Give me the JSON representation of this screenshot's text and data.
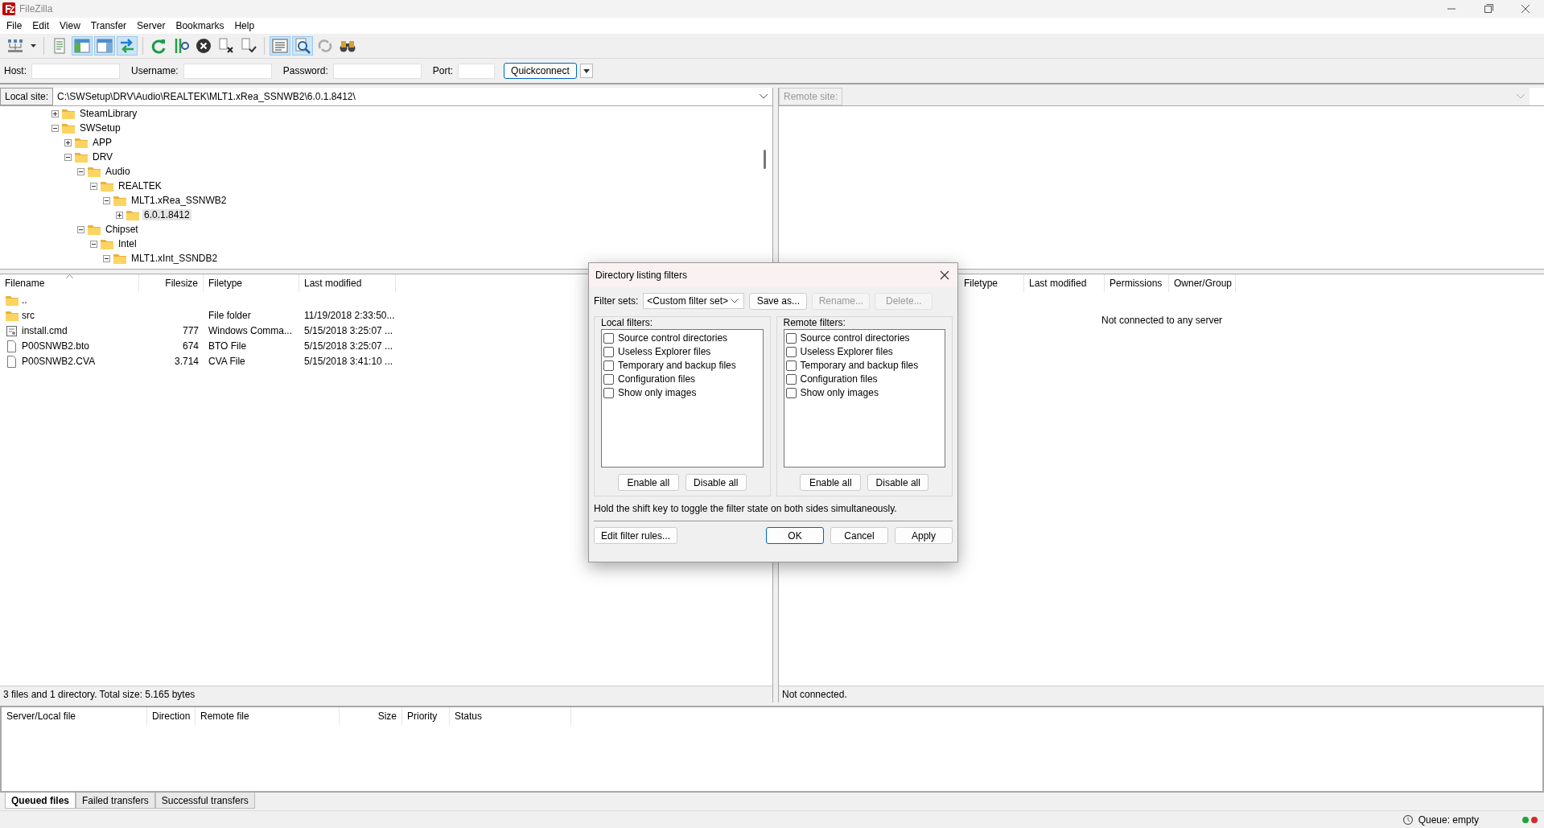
{
  "window": {
    "title": "FileZilla"
  },
  "menu": [
    "File",
    "Edit",
    "View",
    "Transfer",
    "Server",
    "Bookmarks",
    "Help"
  ],
  "toolbar": [
    [
      {
        "kind": "site-manager",
        "pressed": false
      },
      {
        "kind": "dropdown",
        "pressed": false
      }
    ],
    [
      {
        "kind": "message-log",
        "pressed": false
      },
      {
        "kind": "local-tree",
        "pressed": true
      },
      {
        "kind": "remote-tree",
        "pressed": true
      },
      {
        "kind": "transfer-queue",
        "pressed": true
      }
    ],
    [
      {
        "kind": "refresh",
        "pressed": false
      },
      {
        "kind": "process-queue",
        "pressed": false
      },
      {
        "kind": "cancel",
        "pressed": false
      },
      {
        "kind": "disconnect",
        "pressed": false
      },
      {
        "kind": "reconnect",
        "pressed": false
      }
    ],
    [
      {
        "kind": "filter",
        "pressed": true
      },
      {
        "kind": "compare",
        "pressed": true
      },
      {
        "kind": "sync",
        "pressed": false
      },
      {
        "kind": "search",
        "pressed": false
      }
    ]
  ],
  "quickconnect": {
    "fields": [
      {
        "label": "Host:",
        "kind": "host"
      },
      {
        "label": "Username:",
        "kind": "user"
      },
      {
        "label": "Password:",
        "kind": "password"
      },
      {
        "label": "Port:",
        "kind": "port"
      }
    ],
    "button": "Quickconnect"
  },
  "local": {
    "site_label": "Local site:",
    "path": "C:\\SWSetup\\DRV\\Audio\\REALTEK\\MLT1.xRea_SSNWB2\\6.0.1.8412\\",
    "tree": [
      {
        "label": "SteamLibrary",
        "expanded": false,
        "selected": false
      },
      {
        "label": "SWSetup",
        "expanded": true,
        "selected": false,
        "children": [
          {
            "label": "APP",
            "expanded": false,
            "selected": false
          },
          {
            "label": "DRV",
            "expanded": true,
            "selected": false,
            "children": [
              {
                "label": "Audio",
                "expanded": true,
                "selected": false,
                "children": [
                  {
                    "label": "REALTEK",
                    "expanded": true,
                    "selected": false,
                    "children": [
                      {
                        "label": "MLT1.xRea_SSNWB2",
                        "expanded": true,
                        "selected": false,
                        "children": [
                          {
                            "label": "6.0.1.8412",
                            "expanded": false,
                            "selected": true
                          }
                        ]
                      }
                    ]
                  }
                ]
              },
              {
                "label": "Chipset",
                "expanded": true,
                "selected": false,
                "children": [
                  {
                    "label": "Intel",
                    "expanded": true,
                    "selected": false,
                    "children": [
                      {
                        "label": "MLT1.xInt_SSNDB2",
                        "expanded": true,
                        "selected": false
                      }
                    ]
                  }
                ]
              }
            ]
          }
        ]
      }
    ],
    "columns": [
      "Filename",
      "Filesize",
      "Filetype",
      "Last modified"
    ],
    "rows": [
      {
        "kind": "folder",
        "cells": [
          "..",
          "",
          "",
          ""
        ]
      },
      {
        "kind": "folder",
        "cells": [
          "src",
          "",
          "File folder",
          "11/19/2018 2:33:50..."
        ]
      },
      {
        "kind": "script",
        "cells": [
          "install.cmd",
          "777",
          "Windows Comma...",
          "5/15/2018 3:25:07 ..."
        ]
      },
      {
        "kind": "file",
        "cells": [
          "P00SNWB2.bto",
          "674",
          "BTO File",
          "5/15/2018 3:25:07 ..."
        ]
      },
      {
        "kind": "file",
        "cells": [
          "P00SNWB2.CVA",
          "3.714",
          "CVA File",
          "5/15/2018 3:41:10 ..."
        ]
      }
    ],
    "status": "3 files and 1 directory. Total size: 5.165 bytes"
  },
  "remote": {
    "site_label": "Remote site:",
    "columns": [
      "Filetype",
      "Last modified",
      "Permissions",
      "Owner/Group"
    ],
    "message": "Not connected to any server",
    "status": "Not connected."
  },
  "queue": {
    "columns": [
      "Server/Local file",
      "Direction",
      "Remote file",
      "Size",
      "Priority",
      "Status"
    ],
    "tabs": [
      {
        "label": "Queued files",
        "selected": true
      },
      {
        "label": "Failed transfers",
        "selected": false
      },
      {
        "label": "Successful transfers",
        "selected": false
      }
    ]
  },
  "status_bar": {
    "queue": "Queue: empty",
    "lights": [
      {
        "color": "#22a33a"
      },
      {
        "color": "#d42a2a"
      }
    ]
  },
  "dialog": {
    "title": "Directory listing filters",
    "filter_sets_label": "Filter sets:",
    "filter_set": "<Custom filter set>",
    "set_buttons": [
      {
        "label": "Save as...",
        "disabled": false
      },
      {
        "label": "Rename...",
        "disabled": true
      },
      {
        "label": "Delete...",
        "disabled": true
      }
    ],
    "groups": [
      {
        "title": "Local filters:",
        "filters": [
          {
            "label": "Source control directories",
            "checked": false
          },
          {
            "label": "Useless Explorer files",
            "checked": false
          },
          {
            "label": "Temporary and backup files",
            "checked": false
          },
          {
            "label": "Configuration files",
            "checked": false
          },
          {
            "label": "Show only images",
            "checked": false
          }
        ],
        "buttons": [
          "Enable all",
          "Disable all"
        ]
      },
      {
        "title": "Remote filters:",
        "filters": [
          {
            "label": "Source control directories",
            "checked": false
          },
          {
            "label": "Useless Explorer files",
            "checked": false
          },
          {
            "label": "Temporary and backup files",
            "checked": false
          },
          {
            "label": "Configuration files",
            "checked": false
          },
          {
            "label": "Show only images",
            "checked": false
          }
        ],
        "buttons": [
          "Enable all",
          "Disable all"
        ]
      }
    ],
    "hint": "Hold the shift key to toggle the filter state on both sides simultaneously.",
    "edit_button": "Edit filter rules...",
    "buttons": [
      {
        "label": "OK",
        "default": true
      },
      {
        "label": "Cancel",
        "default": false
      },
      {
        "label": "Apply",
        "default": false
      }
    ]
  }
}
